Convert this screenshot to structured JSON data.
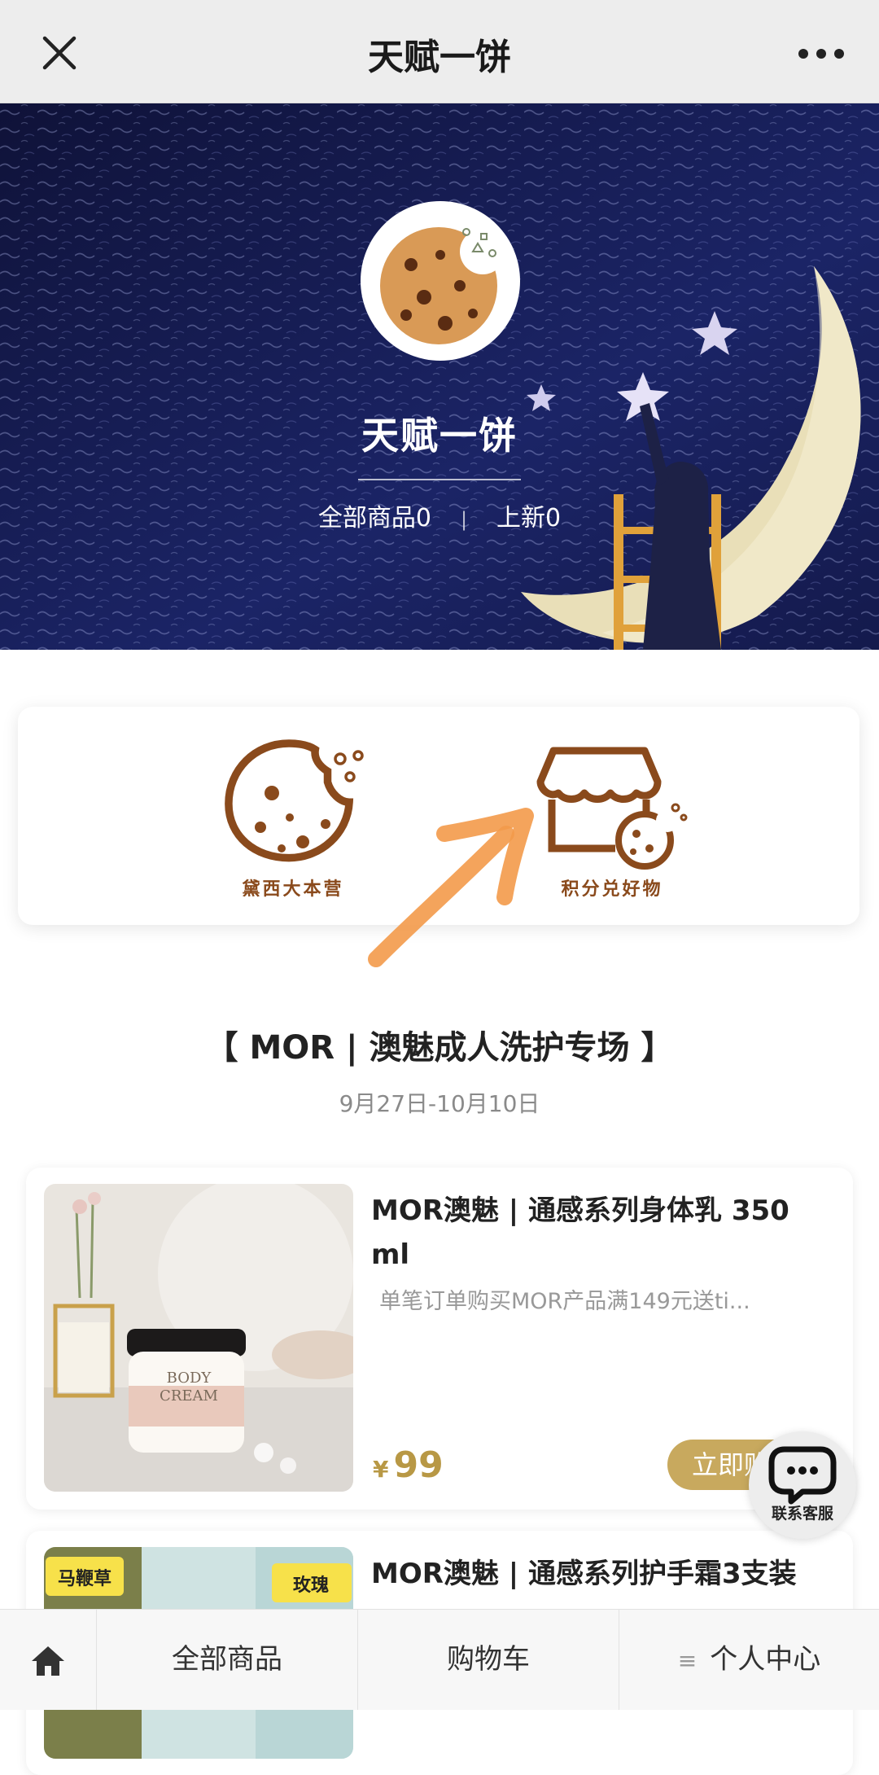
{
  "nav": {
    "title": "天赋一饼",
    "close_icon": "close-icon",
    "more_icon": "more-dots-icon"
  },
  "hero": {
    "shop_name": "天赋一饼",
    "all_products": "全部商品0",
    "separator": "|",
    "new_arrivals": "上新0"
  },
  "entries": [
    {
      "label": "黛西大本营",
      "icon": "cookie-icon"
    },
    {
      "label": "积分兑好物",
      "icon": "store-cookie-icon"
    }
  ],
  "section": {
    "title": "【 MOR | 澳魅成人洗护专场 】",
    "date_range": "9月27日-10月10日"
  },
  "products": [
    {
      "name": "MOR澳魅 | 通感系列身体乳 350 ml",
      "desc": "单笔订单购买MOR产品满149元送ti...",
      "currency": "¥",
      "price": "99",
      "buy_label": "立即购买",
      "jar_text_1": "BODY",
      "jar_text_2": "CREAM"
    },
    {
      "name": "MOR澳魅 | 通感系列护手霜3支装",
      "tag_1": "马鞭草",
      "tag_2": "玫瑰"
    }
  ],
  "service": {
    "label": "联系客服",
    "icon": "chat-bubble-icon"
  },
  "bottom_nav": {
    "home_icon": "home-icon",
    "all_products": "全部商品",
    "cart": "购物车",
    "menu_icon": "≡",
    "profile": "个人中心"
  },
  "colors": {
    "accent_gold": "#c8a95e",
    "price_gold": "#b89845",
    "entry_brown": "#8a4a1c",
    "hero_blue": "#151a4a"
  }
}
